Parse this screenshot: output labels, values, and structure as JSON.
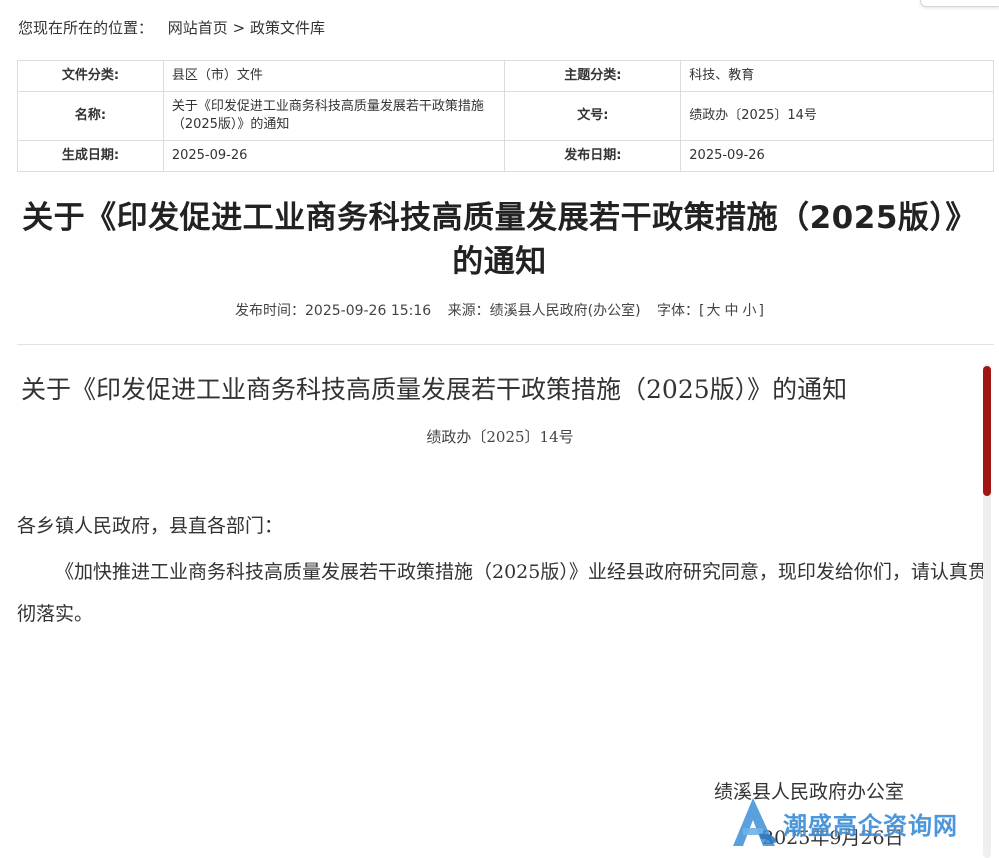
{
  "breadcrumb": {
    "prefix": "您现在所在的位置：",
    "home": "网站首页",
    "separator": ">",
    "current": "政策文件库"
  },
  "meta": {
    "category_label": "文件分类:",
    "category_value": "县区（市）文件",
    "topic_label": "主题分类:",
    "topic_value": "科技、教育",
    "name_label": "名称:",
    "name_value": "关于《印发促进工业商务科技高质量发展若干政策措施（2025版）》的通知",
    "docno_label": "文号:",
    "docno_value": "绩政办〔2025〕14号",
    "created_label": "生成日期:",
    "created_value": "2025-09-26",
    "published_label": "发布日期:",
    "published_value": "2025-09-26"
  },
  "article": {
    "title": "关于《印发促进工业商务科技高质量发展若干政策措施（2025版）》的通知",
    "pub_time": "发布时间：2025-09-26 15:16",
    "source": "来源：绩溪县人民政府(办公室)",
    "font_label": "字体：[",
    "font_large": "大",
    "font_medium": "中",
    "font_small": "小",
    "font_close": "]"
  },
  "document": {
    "title": "关于《印发促进工业商务科技高质量发展若干政策措施（2025版）》的通知",
    "number": "绩政办〔2025〕14号",
    "salutation": "各乡镇人民政府，县直各部门：",
    "body": "《加快推进工业商务科技高质量发展若干政策措施（2025版）》业经县政府研究同意，现印发给你们，请认真贯彻落实。",
    "sign_org": "绩溪县人民政府办公室",
    "sign_date": "2025年9月26日"
  },
  "watermark": {
    "text": "潮盛高企资询网",
    "icon": "a-logo-icon"
  },
  "colors": {
    "scroll_thumb": "#a11515",
    "watermark": "#3d8fd6"
  }
}
